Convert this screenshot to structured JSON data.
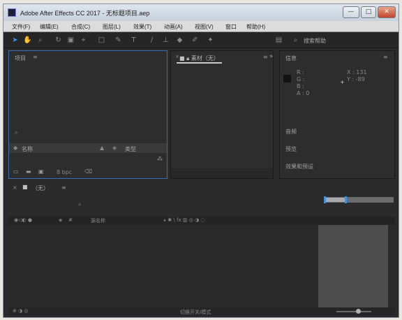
{
  "window": {
    "title": "Adobe After Effects CC 2017 - 无标题项目.aep",
    "minimize": "—",
    "maximize": "□",
    "close": "✕"
  },
  "menu": [
    "文件(F)",
    "编辑(E)",
    "合成(C)",
    "图层(L)",
    "效果(T)",
    "动画(A)",
    "视图(V)",
    "窗口",
    "帮助(H)"
  ],
  "toolbar": {
    "tools": [
      "selection-icon",
      "hand-icon",
      "zoom-icon",
      "rotate-icon",
      "camera-icon",
      "pan-behind-icon",
      "rectangle-icon",
      "pen-icon",
      "type-icon",
      "brush-icon",
      "clone-icon",
      "eraser-icon",
      "roto-icon",
      "puppet-icon"
    ],
    "search_help": "搜索帮助"
  },
  "project": {
    "title": "项目",
    "col_name": "名称",
    "col_type": "类型",
    "bpc": "8 bpc"
  },
  "footage": {
    "title": "素材（无）"
  },
  "info": {
    "title": "信息",
    "r": "R :",
    "g": "G :",
    "b": "B :",
    "a": "A : 0",
    "x": "X : 131",
    "y": "Y : -89",
    "audio": "音频",
    "preview": "预览",
    "effects": "效果和预设"
  },
  "timeline": {
    "title": "（无）",
    "source_name": "源名称",
    "mode_label": "切换开关/模式"
  }
}
